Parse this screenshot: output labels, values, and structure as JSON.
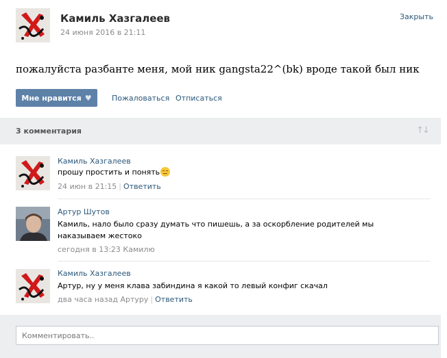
{
  "post": {
    "author": "Камиль Хазгалеев",
    "date": "24 июня 2016 в 21:11",
    "close_label": "Закрыть",
    "text": "пожалуйста разбанте меня, мой ник gangsta22^(bk) вроде такой был ник",
    "like_label": "Мне нравится",
    "report_label": "Пожаловаться",
    "unsubscribe_label": "Отписаться"
  },
  "comments_header": {
    "count_label": "3 комментария",
    "sort_icon": "sort-arrows-icon"
  },
  "comments": [
    {
      "author": "Камиль Хазгалеев",
      "text": "прошу простить и понять",
      "emoji": "pensive-face-icon",
      "time": "24 июн в 21:15",
      "reply_label": "Ответить",
      "avatar": "red-logo"
    },
    {
      "author": "Артур Шутов",
      "text": "Камиль, нало было сразу думать что пишешь, а за оскорбление родителей мы наказываем жестоко",
      "time": "сегодня в 13:23 Камилю",
      "avatar": "photo"
    },
    {
      "author": "Камиль Хазгалеев",
      "text": "Артур, ну у меня клава забиндина я какой то левый конфиг скачал",
      "time": "два часа назад Артуру",
      "reply_label": "Ответить",
      "avatar": "red-logo"
    }
  ],
  "reply": {
    "placeholder": "Комментировать.."
  },
  "colors": {
    "link": "#2b587a",
    "button": "#5e81a8",
    "panel": "#edeef0"
  }
}
